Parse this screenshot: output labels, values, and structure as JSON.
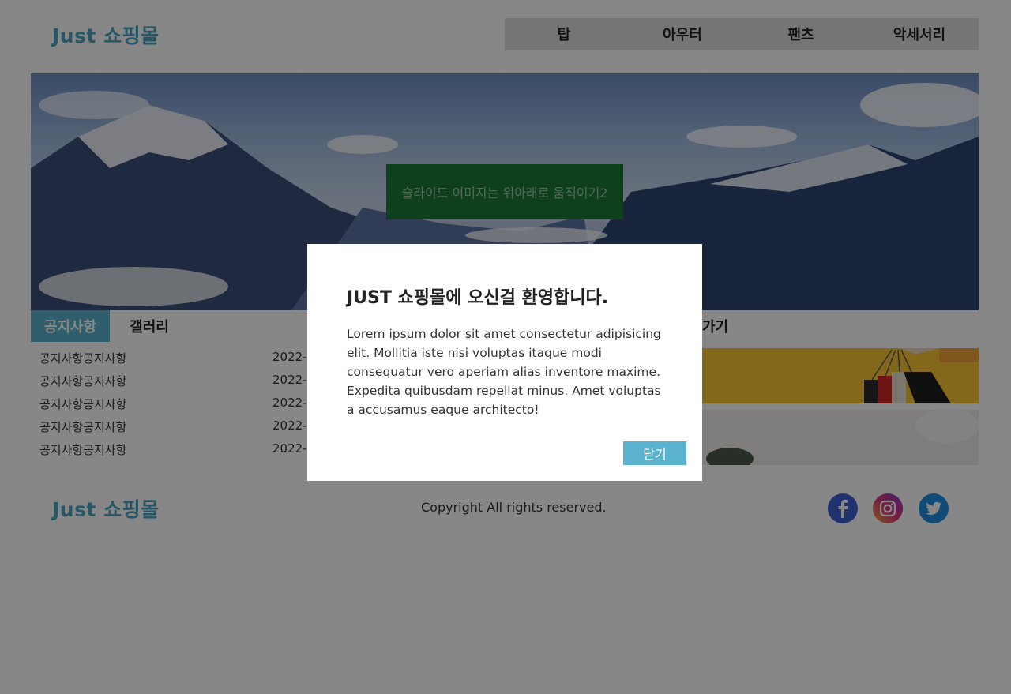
{
  "header": {
    "logo": "Just 쇼핑몰",
    "nav": [
      "탑",
      "아우터",
      "팬츠",
      "악세서리"
    ]
  },
  "slide": {
    "caption": "슬라이드 이미지는 위아래로 움직이기2"
  },
  "tabs": [
    {
      "label": "공지사항",
      "active": true
    },
    {
      "label": "갤러리",
      "active": false
    }
  ],
  "notices": [
    {
      "title": "공지사항공지사항",
      "date": "2022-"
    },
    {
      "title": "공지사항공지사항",
      "date": "2022-"
    },
    {
      "title": "공지사항공지사항",
      "date": "2022-"
    },
    {
      "title": "공지사항공지사항",
      "date": "2022-"
    },
    {
      "title": "공지사항공지사항",
      "date": "2022-"
    }
  ],
  "shortcut": {
    "title": "가기"
  },
  "footer": {
    "logo": "Just 쇼핑몰",
    "copyright": "Copyright All rights reserved.",
    "social": [
      "facebook-icon",
      "instagram-icon",
      "twitter-icon"
    ]
  },
  "modal": {
    "title": "JUST 쇼핑몰에 오신걸 환영합니다.",
    "body": "Lorem ipsum dolor sit amet consectetur adipisicing elit. Mollitia iste nisi voluptas itaque modi consequatur vero aperiam alias inventore maxime. Expedita quibusdam repellat minus. Amet voluptas a accusamus eaque architecto!",
    "close_label": "닫기"
  },
  "colors": {
    "accent": "#5ab2cf",
    "logo": "#4aa3c0",
    "caption_bg": "#1e7a3a"
  }
}
